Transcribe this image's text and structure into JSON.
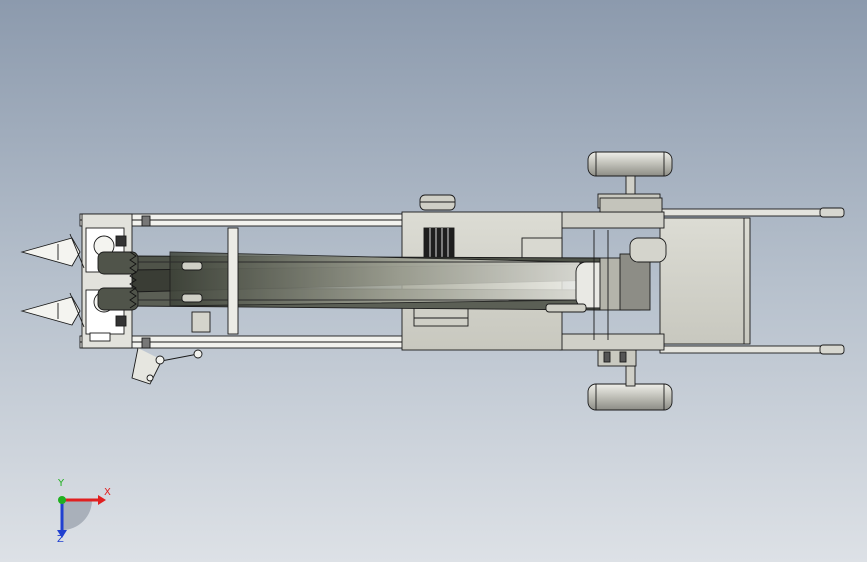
{
  "viewport": {
    "background_top": "#8c9aad",
    "background_bottom": "#dde1e6"
  },
  "model": {
    "line_color": "#1a1a1a",
    "frame_fill": "#f2f2ee",
    "plate_fill": "#d8d8d0",
    "wheel_fill": "#bdbdb5",
    "belt_fill": "#55594f",
    "cone_fill": "#f4f4f0"
  },
  "triad": {
    "x_label": "X",
    "y_label": "Y",
    "z_label": "Z",
    "x_color": "#e02020",
    "y_color": "#20b020",
    "z_color": "#2040d0"
  }
}
